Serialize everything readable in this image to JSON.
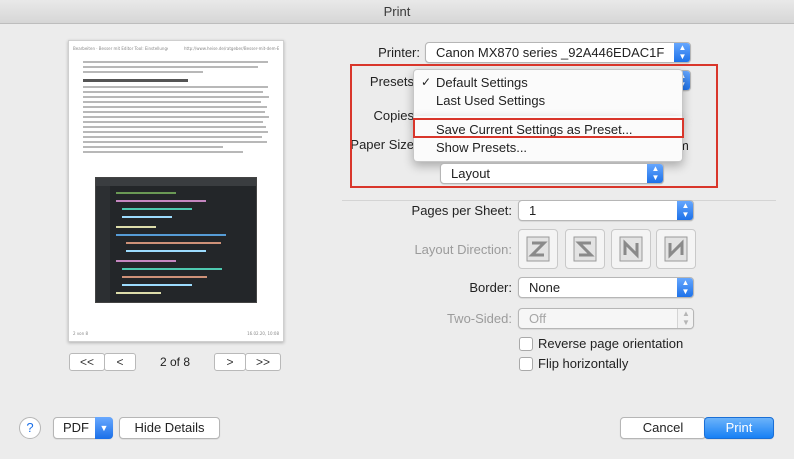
{
  "window": {
    "title": "Print"
  },
  "preview": {
    "header_left": "Bearbeiten · Besser mit Editor Tool: Einstellungen aus einem Editor",
    "header_right": "http://www.heise.de/ratgeber/Besser-mit-dem-Editor-Tool-Bearbeiten",
    "footer_left": "2 von 8",
    "footer_right": "16.02.20, 10:08"
  },
  "pager": {
    "first": "<<",
    "prev": "<",
    "label": "2 of 8",
    "next": ">",
    "last": ">>"
  },
  "printer": {
    "label": "Printer:",
    "value": "Canon MX870 series _92A446EDAC1F"
  },
  "presets": {
    "label": "Presets"
  },
  "copies": {
    "label": "Copies"
  },
  "paper_size": {
    "label": "Paper Size",
    "suffix": "m"
  },
  "section": {
    "value": "Layout"
  },
  "menu": {
    "check": "✓",
    "items": [
      "Default Settings",
      "Last Used Settings",
      "Save Current Settings as Preset...",
      "Show Presets..."
    ]
  },
  "pages_per_sheet": {
    "label": "Pages per Sheet:",
    "value": "1"
  },
  "layout_direction": {
    "label": "Layout Direction:"
  },
  "border": {
    "label": "Border:",
    "value": "None"
  },
  "two_sided": {
    "label": "Two-Sided:",
    "value": "Off"
  },
  "reverse": {
    "label": "Reverse page orientation"
  },
  "flip": {
    "label": "Flip horizontally"
  },
  "bottom": {
    "help": "?",
    "pdf": "PDF",
    "hide_details": "Hide Details",
    "cancel": "Cancel",
    "print": "Print"
  },
  "colors": {
    "accent": "#1a6fe8",
    "highlight": "#d9362b"
  }
}
